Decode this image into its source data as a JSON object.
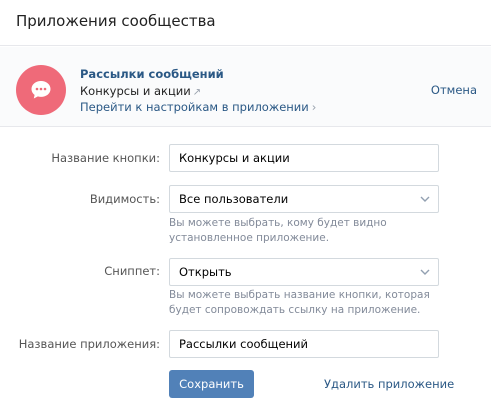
{
  "header": {
    "title": "Приложения сообщества"
  },
  "app_card": {
    "name": "Рассылки сообщений",
    "button_name": "Конкурсы и акции",
    "button_name_icon": "external-arrow-icon",
    "settings_link": "Перейти к настройкам в приложении",
    "settings_link_icon": "chevron-right-icon",
    "cancel": "Отмена",
    "avatar_icon": "chat-bubble-icon",
    "avatar_color": "#ef6a79"
  },
  "form": {
    "button_name": {
      "label": "Название кнопки:",
      "value": "Конкурсы и акции"
    },
    "visibility": {
      "label": "Видимость:",
      "value": "Все пользователи",
      "hint": "Вы можете выбрать, кому будет видно установленное приложение."
    },
    "snippet": {
      "label": "Сниппет:",
      "value": "Открыть",
      "hint": "Вы можете выбрать название кнопки, которая будет сопровождать ссылку на приложение."
    },
    "app_name": {
      "label": "Название приложения:",
      "value": "Рассылки сообщений"
    }
  },
  "actions": {
    "save": "Сохранить",
    "delete": "Удалить приложение"
  },
  "colors": {
    "accent": "#5181b8",
    "link": "#2a5885"
  }
}
